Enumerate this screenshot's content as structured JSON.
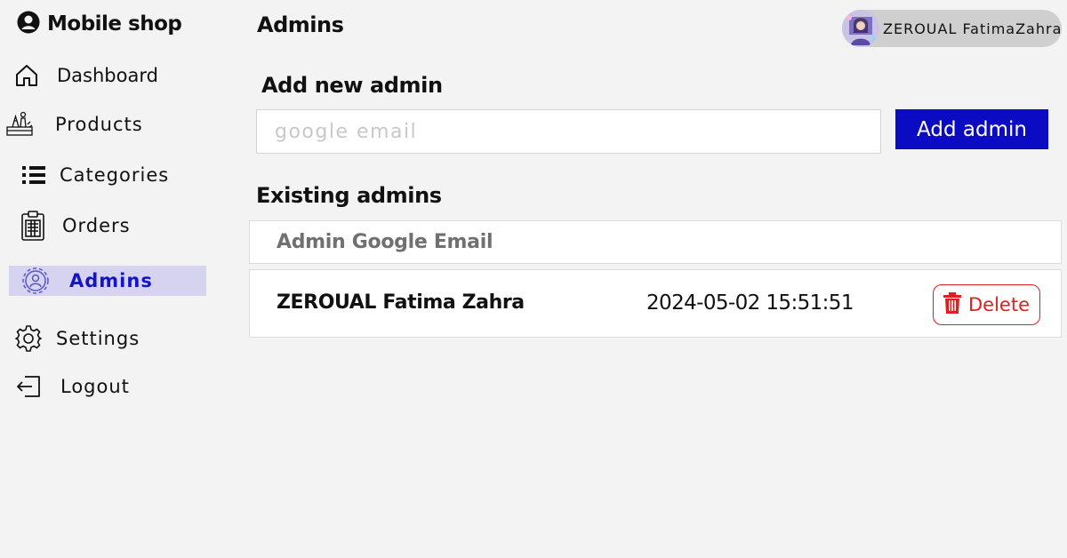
{
  "app": {
    "title": "Mobile shop"
  },
  "sidebar": {
    "items": [
      {
        "label": "Dashboard",
        "icon": "home-icon"
      },
      {
        "label": "Products",
        "icon": "products-icon"
      },
      {
        "label": "Categories",
        "icon": "list-icon"
      },
      {
        "label": "Orders",
        "icon": "clipboard-icon"
      },
      {
        "label": "Admins",
        "icon": "admin-gear-icon",
        "active": true
      },
      {
        "label": "Settings",
        "icon": "gear-icon"
      },
      {
        "label": "Logout",
        "icon": "logout-icon"
      }
    ]
  },
  "header": {
    "title": "Admins",
    "user_name": "ZEROUAL FatimaZahra"
  },
  "add_admin": {
    "title": "Add new admin",
    "placeholder": "google email",
    "value": "",
    "button_label": "Add admin"
  },
  "existing": {
    "title": "Existing admins",
    "column_header": "Admin Google Email",
    "rows": [
      {
        "name": "ZEROUAL Fatima Zahra",
        "date": "2024-05-02 15:51:51",
        "delete_label": "Delete"
      }
    ]
  },
  "colors": {
    "accent": "#0b0bc4",
    "active_bg": "#d6d3f0",
    "danger": "#e02020",
    "background": "#f3f3f3"
  }
}
